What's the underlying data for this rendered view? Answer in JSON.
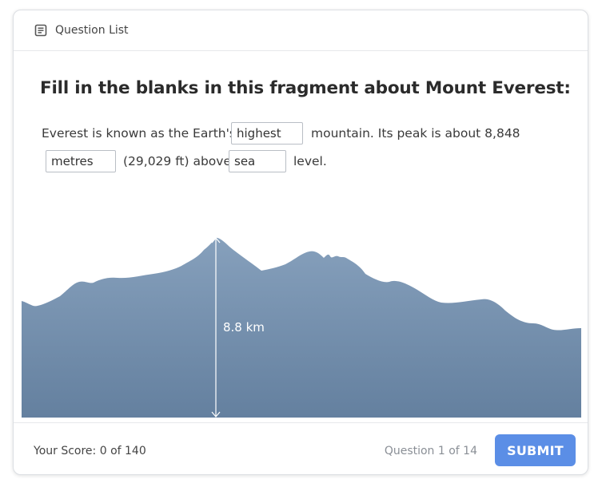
{
  "header": {
    "question_list_label": "Question List",
    "question_list_icon": "document-list-icon"
  },
  "question": {
    "title": "Fill in the blanks in this fragment about Mount Everest:",
    "text_1": "Everest is known as the Earth's",
    "blank_1": "highest",
    "text_2": "mountain. Its peak is about 8,848",
    "blank_2": "metres",
    "text_3": "(29,029 ft) above",
    "blank_3": "sea",
    "text_4": "level."
  },
  "illustration": {
    "height_label": "8.8 km",
    "gradient_top": "#86a0bc",
    "gradient_bottom": "#64809f"
  },
  "footer": {
    "score": "Your Score: 0 of 140",
    "question_counter": "Question 1 of 14",
    "submit_label": "SUBMIT"
  },
  "colors": {
    "accent": "#5b8ee6",
    "mountain": "#7590ae"
  }
}
